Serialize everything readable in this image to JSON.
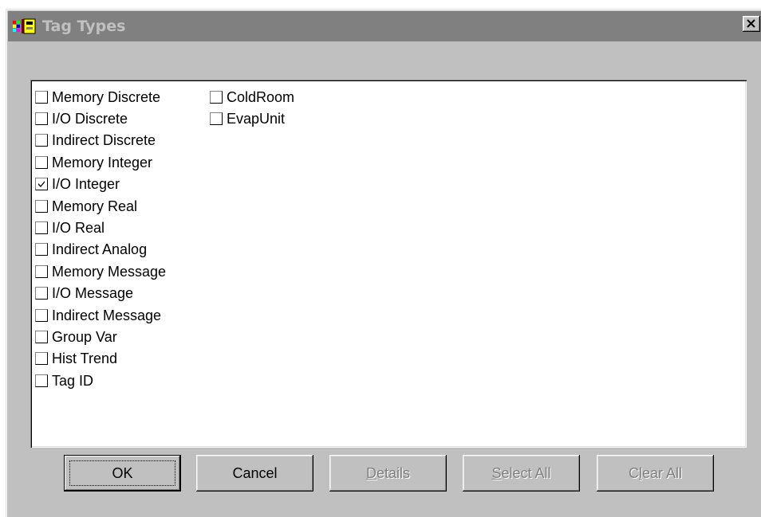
{
  "window": {
    "title": "Tag Types",
    "app_icon": "tag-types-app-icon",
    "close_icon": "close-icon"
  },
  "list": {
    "column1": [
      {
        "label": "Memory Discrete",
        "checked": false
      },
      {
        "label": "I/O Discrete",
        "checked": false
      },
      {
        "label": "Indirect Discrete",
        "checked": false
      },
      {
        "label": "Memory Integer",
        "checked": false
      },
      {
        "label": "I/O Integer",
        "checked": true
      },
      {
        "label": "Memory Real",
        "checked": false
      },
      {
        "label": "I/O Real",
        "checked": false
      },
      {
        "label": "Indirect Analog",
        "checked": false
      },
      {
        "label": "Memory Message",
        "checked": false
      },
      {
        "label": "I/O Message",
        "checked": false
      },
      {
        "label": "Indirect Message",
        "checked": false
      },
      {
        "label": "Group Var",
        "checked": false
      },
      {
        "label": "Hist Trend",
        "checked": false
      },
      {
        "label": "Tag ID",
        "checked": false
      }
    ],
    "column2": [
      {
        "label": "ColdRoom",
        "checked": false
      },
      {
        "label": "EvapUnit",
        "checked": false
      }
    ]
  },
  "buttons": {
    "ok": {
      "label": "OK",
      "enabled": true
    },
    "cancel": {
      "label": "Cancel",
      "enabled": true
    },
    "details": {
      "label": "Details",
      "enabled": false
    },
    "select_all": {
      "label": "Select All",
      "enabled": false
    },
    "clear_all": {
      "label": "Clear All",
      "enabled": false
    }
  },
  "colors": {
    "face": "#c0c0c0",
    "title_inactive": "#808080",
    "title_text": "#c0c0c0",
    "disabled_text": "#808080"
  }
}
